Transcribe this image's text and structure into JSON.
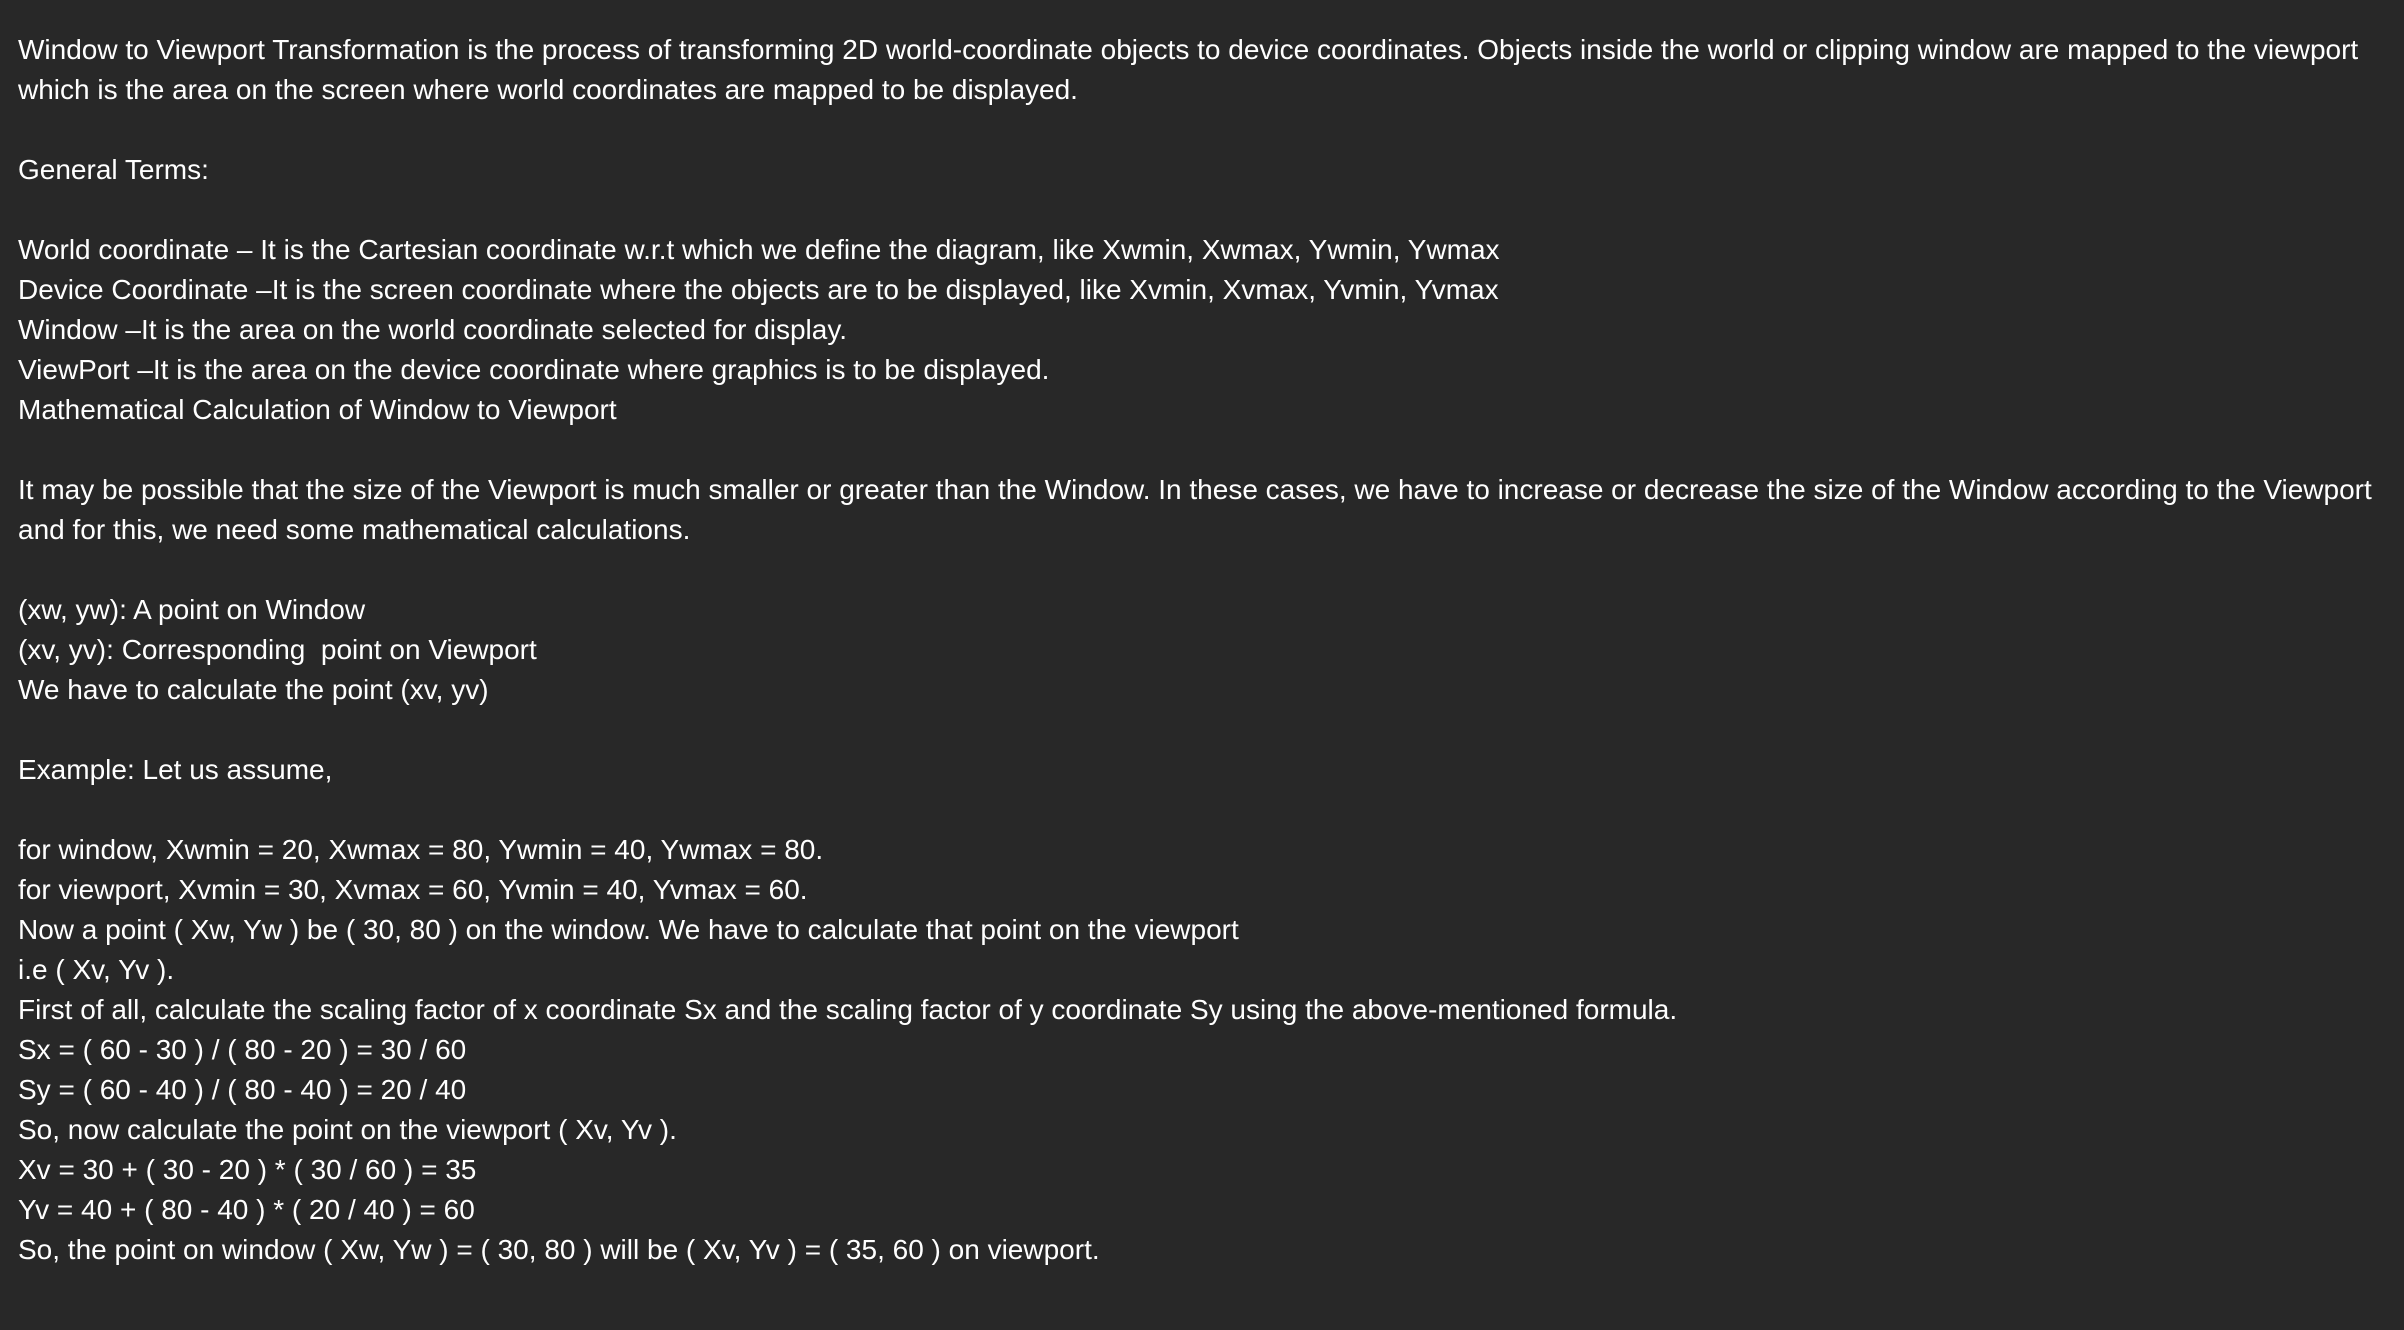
{
  "intro": {
    "line_1": "Window to Viewport Transformation is the process of transforming 2D world-coordinate objects to device coordinates. Objects inside the world or clipping window are mapped to the viewport",
    "line_2": "which is the area on the screen where world coordinates are mapped to be displayed."
  },
  "general_terms": {
    "heading": "General Terms:",
    "items": [
      "World coordinate – It is the Cartesian coordinate w.r.t which we define the diagram, like Xwmin, Xwmax, Ywmin, Ywmax",
      "Device Coordinate –It is the screen coordinate where the objects are to be displayed, like Xvmin, Xvmax, Yvmin, Yvmax",
      "Window –It is the area on the world coordinate selected for display.",
      "ViewPort –It is the area on the device coordinate where graphics is to be displayed.",
      "Mathematical Calculation of Window to Viewport"
    ]
  },
  "calculation_note": {
    "line_1": "It may be possible that the size of the Viewport is much smaller or greater than the Window. In these cases, we have to increase or decrease the size of the Window according to the Viewport",
    "line_2": "and for this, we need some mathematical calculations."
  },
  "points": [
    "(xw, yw): A point on Window",
    "(xv, yv): Corresponding  point on Viewport",
    "We have to calculate the point (xv, yv)"
  ],
  "example": {
    "heading": "Example: Let us assume,",
    "lines": [
      "for window, Xwmin = 20, Xwmax = 80, Ywmin = 40, Ywmax = 80.",
      "for viewport, Xvmin = 30, Xvmax = 60, Yvmin = 40, Yvmax = 60.",
      "Now a point ( Xw, Yw ) be ( 30, 80 ) on the window. We have to calculate that point on the viewport",
      "i.e ( Xv, Yv ).",
      "First of all, calculate the scaling factor of x coordinate Sx and the scaling factor of y coordinate Sy using the above-mentioned formula.",
      "Sx = ( 60 - 30 ) / ( 80 - 20 ) = 30 / 60",
      "Sy = ( 60 - 40 ) / ( 80 - 40 ) = 20 / 40",
      "So, now calculate the point on the viewport ( Xv, Yv ).",
      "Xv = 30 + ( 30 - 20 ) * ( 30 / 60 ) = 35",
      "Yv = 40 + ( 80 - 40 ) * ( 20 / 40 ) = 60",
      "So, the point on window ( Xw, Yw ) = ( 30, 80 ) will be ( Xv, Yv ) = ( 35, 60 ) on viewport."
    ]
  }
}
